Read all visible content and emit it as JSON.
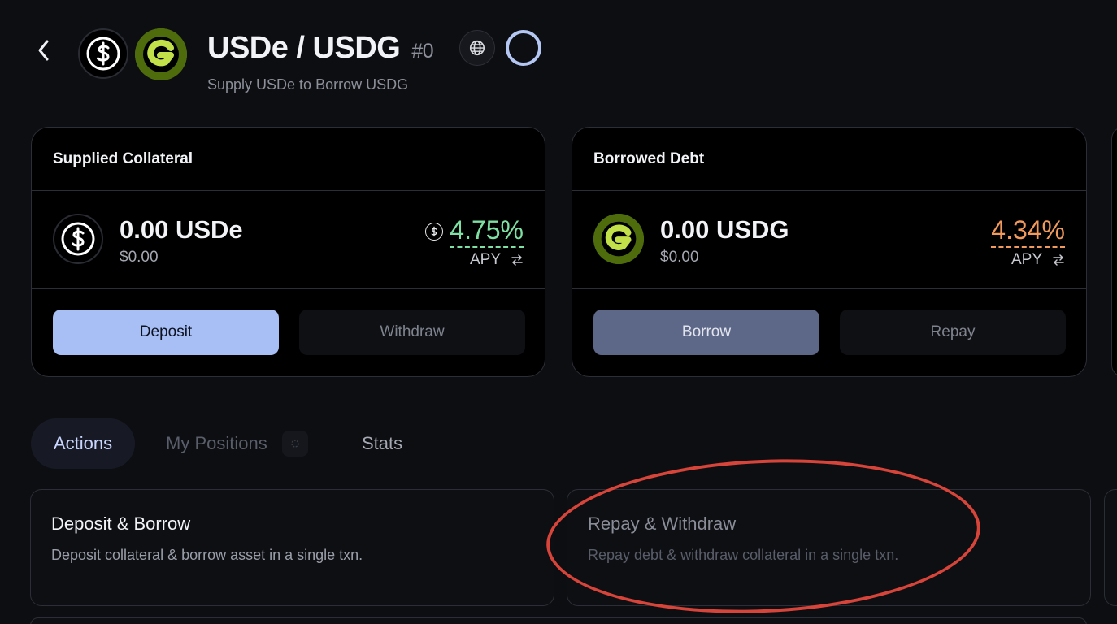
{
  "header": {
    "title": "USDe / USDG",
    "pool_number": "#0",
    "subtitle": "Supply USDe to Borrow USDG",
    "icons": [
      "chevron-left-icon",
      "usde-token-icon",
      "usdg-token-icon",
      "globe-icon",
      "ring-icon"
    ]
  },
  "supplied": {
    "heading": "Supplied Collateral",
    "amount": "0.00 USDe",
    "usd_value": "$0.00",
    "apy": "4.75%",
    "apy_label": "APY",
    "apy_color": "#7ee0a3",
    "primary_button": "Deposit",
    "secondary_button": "Withdraw"
  },
  "borrowed": {
    "heading": "Borrowed Debt",
    "amount": "0.00 USDG",
    "usd_value": "$0.00",
    "apy": "4.34%",
    "apy_label": "APY",
    "apy_color": "#f29a5c",
    "primary_button": "Borrow",
    "secondary_button": "Repay"
  },
  "tabs": [
    {
      "label": "Actions",
      "active": true
    },
    {
      "label": "My Positions",
      "active": false
    },
    {
      "label": "Stats",
      "active": false
    }
  ],
  "action_cards": [
    {
      "title": "Deposit & Borrow",
      "description": "Deposit collateral & borrow asset in a single txn."
    },
    {
      "title": "Repay & Withdraw",
      "description": "Repay debt & withdraw collateral in a single txn."
    }
  ],
  "colors": {
    "background": "#0d0e12",
    "deposit_button": "#a7bff5",
    "borrow_button": "#5d6788",
    "annotation": "#d6443a"
  }
}
